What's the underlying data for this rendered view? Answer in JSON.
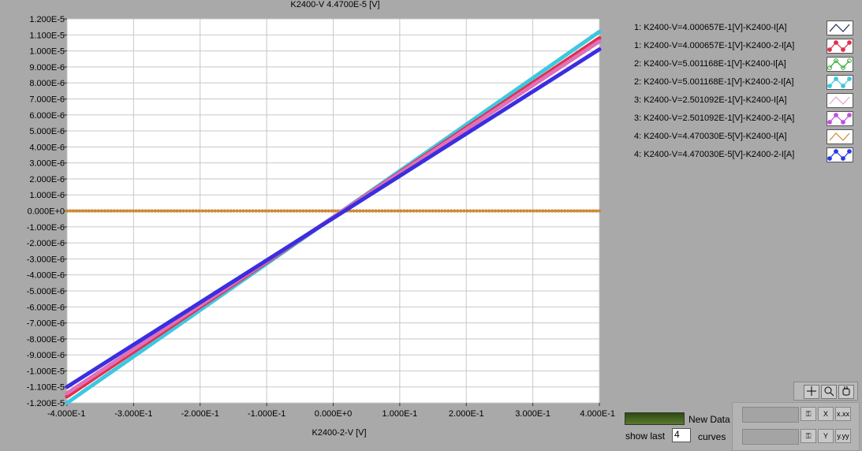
{
  "title": "K2400-V 4.4700E-5 [V]",
  "xlabel": "K2400-2-V  [V]",
  "chart_data": {
    "type": "scatter",
    "xlim": [
      -0.4,
      0.4
    ],
    "ylim": [
      -1.2e-05,
      1.2e-05
    ],
    "x_ticks": [
      "-4.000E-1",
      "-3.000E-1",
      "-2.000E-1",
      "-1.000E-1",
      "0.000E+0",
      "1.000E-1",
      "2.000E-1",
      "3.000E-1",
      "4.000E-1"
    ],
    "x_tick_values": [
      -0.4,
      -0.3,
      -0.2,
      -0.1,
      0,
      0.1,
      0.2,
      0.3,
      0.4
    ],
    "y_ticks": [
      "1.200E-5",
      "1.100E-5",
      "1.000E-5",
      "9.000E-6",
      "8.000E-6",
      "7.000E-6",
      "6.000E-6",
      "5.000E-6",
      "4.000E-6",
      "3.000E-6",
      "2.000E-6",
      "1.000E-6",
      "0.000E+0",
      "-1.000E-6",
      "-2.000E-6",
      "-3.000E-6",
      "-4.000E-6",
      "-5.000E-6",
      "-6.000E-6",
      "-7.000E-6",
      "-8.000E-6",
      "-9.000E-6",
      "-1.000E-5",
      "-1.100E-5",
      "-1.200E-5"
    ],
    "y_tick_values": [
      1.2e-05,
      1.1e-05,
      1e-05,
      9e-06,
      8e-06,
      7e-06,
      6e-06,
      5e-06,
      4e-06,
      3e-06,
      2e-06,
      1e-06,
      0,
      -1e-06,
      -2e-06,
      -3e-06,
      -4e-06,
      -5e-06,
      -6e-06,
      -7e-06,
      -8e-06,
      -9e-06,
      -1e-05,
      -1.1e-05,
      -1.2e-05
    ],
    "grid": true,
    "legend_position": "right",
    "series": [
      {
        "name": "1: K2400-V=4.000657E-1[V]-K2400-I[A]",
        "color": "#1a6a6a",
        "x": [
          -0.4,
          0.4
        ],
        "y": [
          0,
          0
        ]
      },
      {
        "name": "1: K2400-V=4.000657E-1[V]-K2400-2-I[A]",
        "color": "#e0304a",
        "x": [
          -0.4,
          0.4
        ],
        "y": [
          -1.16e-05,
          1.08e-05
        ]
      },
      {
        "name": "2: K2400-V=5.001168E-1[V]-K2400-I[A]",
        "color": "#2aa82a",
        "x": [
          -0.4,
          -0.23
        ],
        "y": [
          0,
          0
        ]
      },
      {
        "name": "2: K2400-V=5.001168E-1[V]-K2400-2-I[A]",
        "color": "#3cc8e0",
        "x": [
          -0.4,
          0.4
        ],
        "y": [
          -1.2e-05,
          1.12e-05
        ]
      },
      {
        "name": "3: K2400-V=2.501092E-1[V]-K2400-I[A]",
        "color": "#e080d0",
        "x": [
          -0.4,
          0.4
        ],
        "y": [
          0,
          0
        ]
      },
      {
        "name": "3: K2400-V=2.501092E-1[V]-K2400-2-I[A]",
        "color": "#e070b8",
        "x": [
          -0.4,
          0.4
        ],
        "y": [
          -1.14e-05,
          1.06e-05
        ]
      },
      {
        "name": "4: K2400-V=4.470030E-5[V]-K2400-I[A]",
        "color": "#d08a2a",
        "x": [
          -0.4,
          0.4
        ],
        "y": [
          0,
          0
        ]
      },
      {
        "name": "4: K2400-V=4.470030E-5[V]-K2400-2-I[A]",
        "color": "#3a2ee0",
        "x": [
          -0.4,
          0.4
        ],
        "y": [
          -1.1e-05,
          1.01e-05
        ]
      }
    ]
  },
  "legend": [
    {
      "label": "1: K2400-V=4.000657E-1[V]-K2400-I[A]",
      "color": "#1a2a5a",
      "marker": "line"
    },
    {
      "label": "1: K2400-V=4.000657E-1[V]-K2400-2-I[A]",
      "color": "#e0304a",
      "marker": "dots"
    },
    {
      "label": "2: K2400-V=5.001168E-1[V]-K2400-I[A]",
      "color": "#2aa82a",
      "marker": "circles"
    },
    {
      "label": "2: K2400-V=5.001168E-1[V]-K2400-2-I[A]",
      "color": "#3cc8e0",
      "marker": "dots"
    },
    {
      "label": "3: K2400-V=2.501092E-1[V]-K2400-I[A]",
      "color": "#e8a0d8",
      "marker": "line"
    },
    {
      "label": "3: K2400-V=2.501092E-1[V]-K2400-2-I[A]",
      "color": "#c050e0",
      "marker": "dots"
    },
    {
      "label": "4: K2400-V=4.470030E-5[V]-K2400-I[A]",
      "color": "#d08a2a",
      "marker": "line"
    },
    {
      "label": "4: K2400-V=4.470030E-5[V]-K2400-2-I[A]",
      "color": "#2a3ae0",
      "marker": "dots"
    }
  ],
  "controls": {
    "new_data_label": "New Data",
    "show_last_label": "show last",
    "show_last_value": "4",
    "curves_label": "curves"
  },
  "tools": {
    "cursor_icon": "crosshair-icon",
    "zoom_icon": "zoom-icon",
    "pan_icon": "hand-icon"
  },
  "scale": {
    "x_format_label": "X",
    "y_format_label": "Y",
    "x_format_value": "x.xx",
    "y_format_value": "y.yy"
  }
}
